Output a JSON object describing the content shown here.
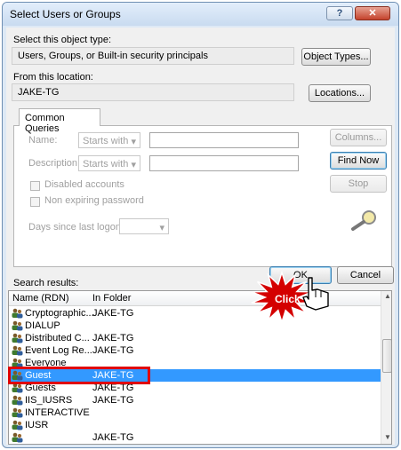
{
  "window": {
    "title": "Select Users or Groups",
    "help_label": "?",
    "close_label": "✕"
  },
  "object_type": {
    "label": "Select this object type:",
    "value": "Users, Groups, or Built-in security principals",
    "button": "Object Types..."
  },
  "location": {
    "label": "From this location:",
    "value": "JAKE-TG",
    "button": "Locations..."
  },
  "queries": {
    "tab": "Common Queries",
    "name_label": "Name:",
    "name_mode": "Starts with",
    "desc_label": "Description:",
    "desc_mode": "Starts with",
    "disabled_accounts": "Disabled accounts",
    "non_expiring": "Non expiring password",
    "days_label": "Days since last logon:",
    "columns_button": "Columns...",
    "find_button": "Find Now",
    "stop_button": "Stop"
  },
  "actions": {
    "ok": "OK",
    "cancel": "Cancel",
    "click_badge": "Click"
  },
  "results": {
    "label": "Search results:",
    "columns": [
      "Name (RDN)",
      "In Folder"
    ],
    "rows": [
      {
        "name": "Cryptographic...",
        "folder": "JAKE-TG"
      },
      {
        "name": "DIALUP",
        "folder": ""
      },
      {
        "name": "Distributed C...",
        "folder": "JAKE-TG"
      },
      {
        "name": "Event Log Re...",
        "folder": "JAKE-TG"
      },
      {
        "name": "Everyone",
        "folder": ""
      },
      {
        "name": "Guest",
        "folder": "JAKE-TG"
      },
      {
        "name": "Guests",
        "folder": "JAKE-TG"
      },
      {
        "name": "IIS_IUSRS",
        "folder": "JAKE-TG"
      },
      {
        "name": "INTERACTIVE",
        "folder": ""
      },
      {
        "name": "IUSR",
        "folder": ""
      },
      {
        "name": "",
        "folder": "JAKE-TG"
      }
    ],
    "selected_index": 5
  },
  "colors": {
    "selection": "#3399ff",
    "highlight_box": "#e00000",
    "badge": "#d40000"
  }
}
